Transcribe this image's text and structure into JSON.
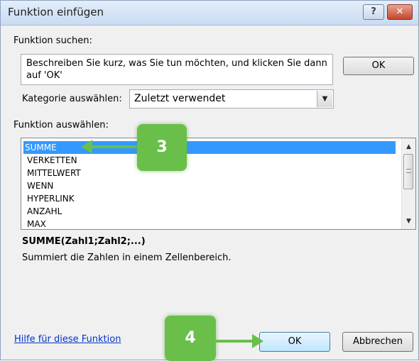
{
  "window": {
    "title": "Funktion einfügen",
    "help_btn": "?",
    "close_btn": "✕"
  },
  "search": {
    "label": "Funktion suchen:",
    "text": "Beschreiben Sie kurz, was Sie tun möchten, und klicken Sie dann auf 'OK'",
    "ok_label": "OK"
  },
  "category": {
    "label": "Kategorie auswählen:",
    "selected": "Zuletzt verwendet",
    "arrow_icon": "chevron-down-icon"
  },
  "functions": {
    "label": "Funktion auswählen:",
    "items": [
      "SUMME",
      "VERKETTEN",
      "MITTELWERT",
      "WENN",
      "HYPERLINK",
      "ANZAHL",
      "MAX"
    ],
    "selected": "SUMME"
  },
  "signature": "SUMME(Zahl1;Zahl2;...)",
  "description": "Summiert die Zahlen in einem Zellenbereich.",
  "footer": {
    "help_link": "Hilfe für diese Funktion",
    "ok_label": "OK",
    "cancel_label": "Abbrechen"
  },
  "annotations": {
    "step3": "3",
    "step4": "4",
    "color": "#6abf4b"
  },
  "colors": {
    "selection": "#3399ff",
    "link": "#0033cc"
  }
}
